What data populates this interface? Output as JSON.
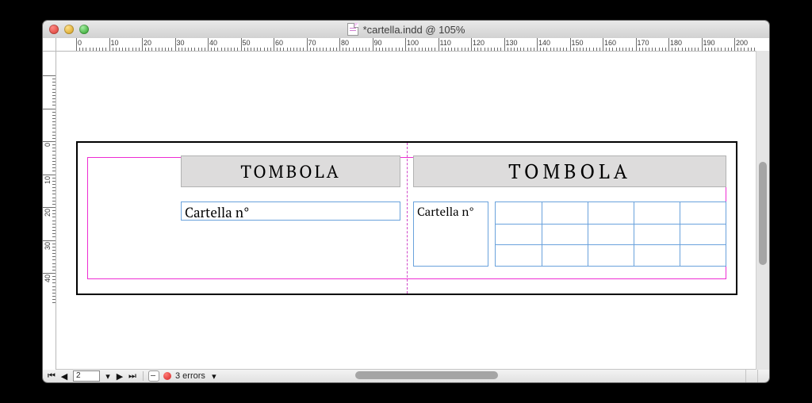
{
  "window": {
    "title": "*cartella.indd @ 105%"
  },
  "ruler": {
    "h_values": [
      0,
      10,
      20,
      30,
      40,
      50,
      60,
      70,
      80,
      90,
      100,
      110,
      120,
      130,
      140,
      150,
      160,
      170,
      180,
      190,
      200
    ],
    "v_values": [
      0,
      10,
      20,
      30,
      40
    ]
  },
  "document": {
    "stub": {
      "title": "TOMBOLA",
      "label": "Cartella n°"
    },
    "card": {
      "title": "TOMBOLA",
      "label": "Cartella n°",
      "grid": {
        "rows": 3,
        "cols": 5
      }
    }
  },
  "status": {
    "page": "2",
    "errors_label": "3 errors"
  }
}
